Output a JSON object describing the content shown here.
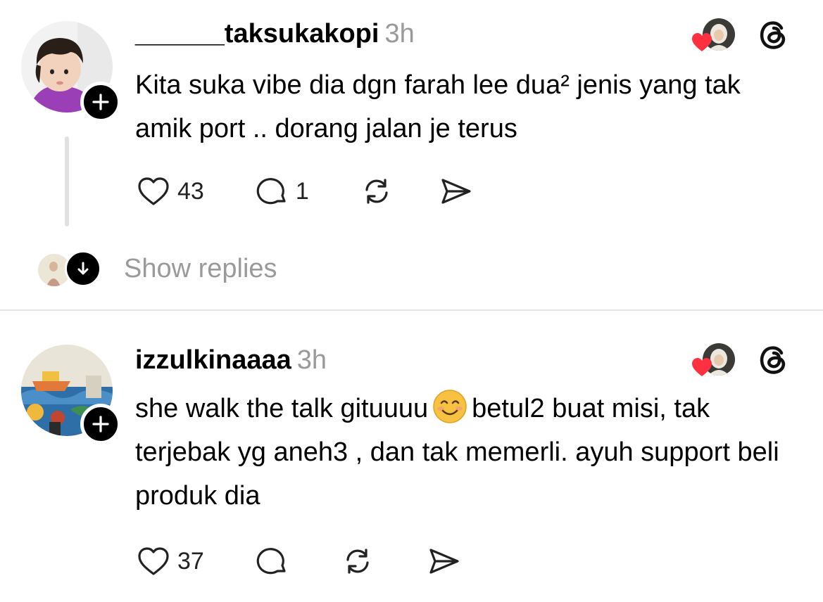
{
  "posts": [
    {
      "username": "______taksukakopi",
      "time": "3h",
      "text": "Kita suka vibe dia dgn farah lee dua² jenis yang tak amik port .. dorang jalan je terus",
      "likes": "43",
      "replies": "1",
      "avatar_icon": "toddler-photo-avatar",
      "liked_by_creator": true
    },
    {
      "username": "izzulkinaaaa",
      "time": "3h",
      "text_before_emoji": "she walk the talk gituuuu",
      "emoji_icon": "smiling-face-emoji",
      "text_after_emoji": "betul2 buat misi, tak terjebak yg aneh3 , dan tak memerli. ayuh support beli produk dia",
      "likes": "37",
      "avatar_icon": "mural-artwork-avatar",
      "liked_by_creator": true
    }
  ],
  "show_replies_label": "Show replies",
  "colors": {
    "heart": "#ff3040",
    "muted_text": "#9a9a9a",
    "divider": "#e4e4e4",
    "thread_line": "#e1e1e1"
  }
}
